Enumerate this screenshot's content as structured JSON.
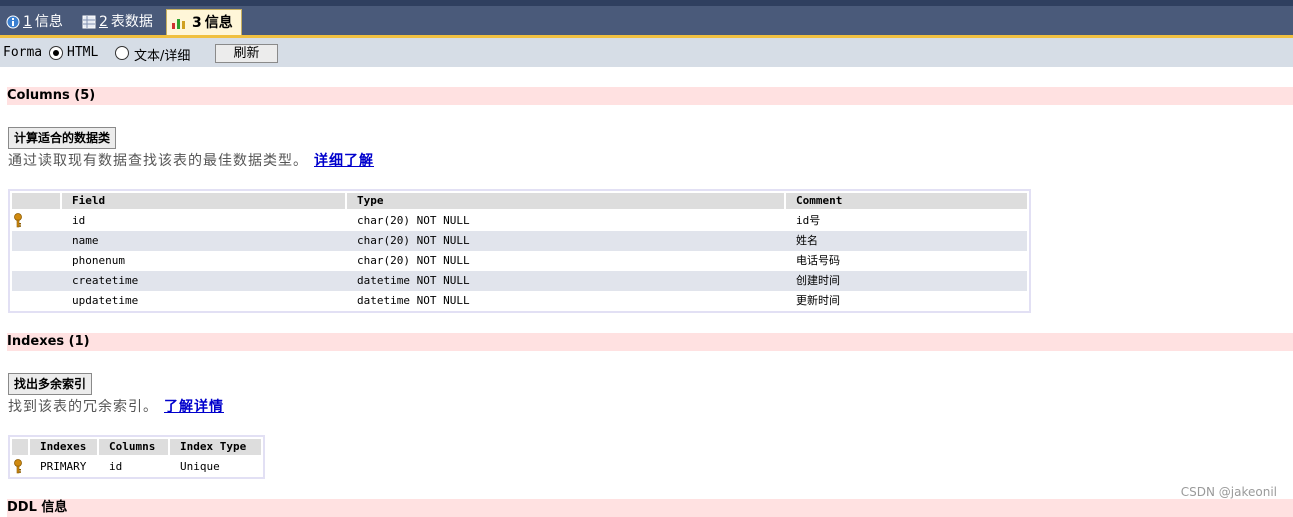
{
  "tabs": [
    {
      "num": "1",
      "label": "信息",
      "icon": "info-icon",
      "active": false
    },
    {
      "num": "2",
      "label": "表数据",
      "icon": "table-icon",
      "active": false
    },
    {
      "num": "3",
      "label": "信息",
      "icon": "chart-icon",
      "active": true
    }
  ],
  "format_bar": {
    "label": "Forma",
    "option_html": "HTML",
    "option_text": "文本/详细",
    "selected": "HTML",
    "refresh_label": "刷新"
  },
  "columns_section": {
    "header": "Columns (5)",
    "button_label": "计算适合的数据类",
    "description": "通过读取现有数据查找该表的最佳数据类型。",
    "link_label": "详细了解",
    "table_headers": [
      "Field",
      "Type",
      "Comment"
    ],
    "rows": [
      {
        "field": "id",
        "type": "char(20) NOT NULL",
        "comment": "id号",
        "primary": true
      },
      {
        "field": "name",
        "type": "char(20) NOT NULL",
        "comment": "姓名",
        "primary": false
      },
      {
        "field": "phonenum",
        "type": "char(20) NOT NULL",
        "comment": "电话号码",
        "primary": false
      },
      {
        "field": "createtime",
        "type": "datetime NOT NULL",
        "comment": "创建时间",
        "primary": false
      },
      {
        "field": "updatetime",
        "type": "datetime NOT NULL",
        "comment": "更新时间",
        "primary": false
      }
    ]
  },
  "indexes_section": {
    "header": "Indexes (1)",
    "button_label": "找出多余索引",
    "description": "找到该表的冗余索引。",
    "link_label": "了解详情",
    "table_headers": [
      "Indexes",
      "Columns",
      "Index Type"
    ],
    "rows": [
      {
        "index": "PRIMARY",
        "columns": "id",
        "type": "Unique",
        "primary": true
      }
    ]
  },
  "ddl_section": {
    "header": "DDL 信息"
  },
  "watermark": "CSDN @jakeonil",
  "colors": {
    "tabbar": "#4a5a7a",
    "tab_underline": "#f0c040",
    "format_bar": "#d6dde6",
    "section_header": "#ffe1e1",
    "link": "#0000cc",
    "row_alt": "#e1e4ec",
    "key_icon": "#d08a10"
  }
}
